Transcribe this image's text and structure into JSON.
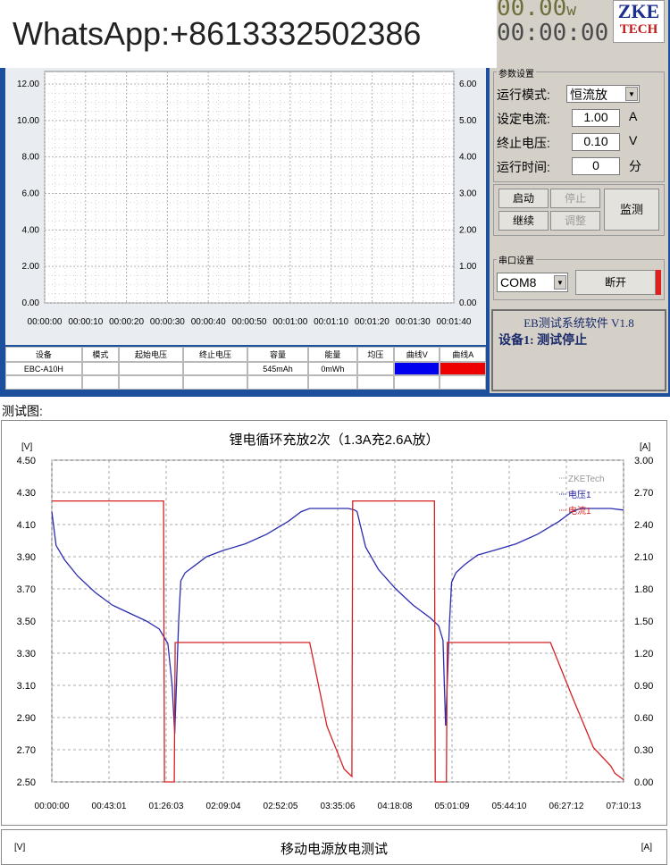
{
  "banner": {
    "text": "WhatsApp:+8613332502386"
  },
  "lcd": {
    "power_value": "00.00",
    "power_unit": "w",
    "time_value": "00:00:00"
  },
  "logo": {
    "line1": "ZKE",
    "line2": "TECH"
  },
  "params": {
    "group_title": "参数设置",
    "mode_label": "运行模式:",
    "mode_value": "恒流放",
    "current_label": "设定电流:",
    "current_value": "1.00",
    "current_unit": "A",
    "stopv_label": "终止电压:",
    "stopv_value": "0.10",
    "stopv_unit": "V",
    "time_label": "运行时间:",
    "time_value": "0",
    "time_unit": "分"
  },
  "buttons": {
    "start": "启动",
    "stop": "停止",
    "continue": "继续",
    "adjust": "调整",
    "monitor": "监测",
    "disconnect": "断开"
  },
  "serial": {
    "group_title": "串口设置",
    "port": "COM8"
  },
  "status": {
    "title": "EB测试系统软件 V1.8",
    "message": "设备1: 测试停止"
  },
  "top_chart": {
    "left_ticks": [
      "12.00",
      "10.00",
      "8.00",
      "6.00",
      "4.00",
      "2.00",
      "0.00"
    ],
    "right_ticks": [
      "6.00",
      "5.00",
      "4.00",
      "3.00",
      "2.00",
      "1.00",
      "0.00"
    ],
    "x_ticks": [
      "00:00:00",
      "00:00:10",
      "00:00:20",
      "00:00:30",
      "00:00:40",
      "00:00:50",
      "00:01:00",
      "00:01:10",
      "00:01:20",
      "00:01:30",
      "00:01:40"
    ]
  },
  "device_table": {
    "headers": [
      "设备",
      "模式",
      "起始电压",
      "终止电压",
      "容量",
      "能量",
      "均压",
      "曲线V",
      "曲线A"
    ],
    "row": [
      "EBC-A10H",
      "",
      "",
      "",
      "545mAh",
      "0mWh",
      "",
      "",
      ""
    ],
    "curve_v_color": "#0000ee",
    "curve_a_color": "#ee0000"
  },
  "caption": "测试图:",
  "chart_data": [
    {
      "type": "line",
      "title": "锂电循环充放2次（1.3A充2.6A放）",
      "y_left_unit": "[V]",
      "y_right_unit": "[A]",
      "y_left_ticks": [
        "4.50",
        "4.30",
        "4.10",
        "3.90",
        "3.70",
        "3.50",
        "3.30",
        "3.10",
        "2.90",
        "2.70",
        "2.50"
      ],
      "y_right_ticks": [
        "3.00",
        "2.70",
        "2.40",
        "2.10",
        "1.80",
        "1.50",
        "1.20",
        "0.90",
        "0.60",
        "0.30",
        "0.00"
      ],
      "x_ticks": [
        "00:00:00",
        "00:43:01",
        "01:26:03",
        "02:09:04",
        "02:52:05",
        "03:35:06",
        "04:18:08",
        "05:01:09",
        "05:44:10",
        "06:27:12",
        "07:10:13"
      ],
      "ylim_left": [
        2.5,
        4.5
      ],
      "ylim_right": [
        0,
        3.0
      ],
      "legend": [
        "ZKETech",
        "电压1",
        "电流1"
      ],
      "legend_colors": [
        "#999999",
        "#2b2bb0",
        "#d42020"
      ],
      "series": [
        {
          "name": "电压1",
          "axis": "left",
          "color": "#2b2bb0",
          "x": [
            0,
            1,
            3,
            6,
            10,
            14,
            18,
            22,
            25,
            27,
            28,
            28.6,
            29,
            29.5,
            30,
            31,
            33,
            36,
            40,
            45,
            50,
            55,
            58,
            60,
            61,
            64,
            67,
            69,
            70.5,
            71,
            73,
            76,
            80,
            84,
            88,
            90,
            91,
            91.6,
            92,
            92.5,
            93,
            94,
            96,
            99,
            103,
            108,
            113,
            118,
            121,
            123,
            124,
            127,
            130,
            133
          ],
          "v": [
            4.18,
            3.97,
            3.88,
            3.78,
            3.68,
            3.6,
            3.55,
            3.5,
            3.45,
            3.36,
            3.1,
            2.8,
            3.1,
            3.5,
            3.75,
            3.8,
            3.84,
            3.9,
            3.94,
            3.98,
            4.04,
            4.12,
            4.18,
            4.2,
            4.2,
            4.2,
            4.2,
            4.2,
            4.19,
            4.18,
            3.96,
            3.82,
            3.7,
            3.6,
            3.52,
            3.47,
            3.38,
            2.85,
            3.12,
            3.48,
            3.74,
            3.8,
            3.85,
            3.91,
            3.94,
            3.98,
            4.04,
            4.12,
            4.18,
            4.2,
            4.2,
            4.2,
            4.2,
            4.19
          ]
        },
        {
          "name": "电流1",
          "axis": "right",
          "color": "#d42020",
          "x": [
            0,
            15,
            26,
            26.2,
            28.5,
            28.7,
            29.8,
            30,
            50,
            55,
            60,
            64,
            68,
            69.8,
            70,
            70.2,
            85,
            89,
            89.2,
            91.8,
            92,
            93,
            93.2,
            111,
            116,
            121,
            126,
            130,
            131,
            133
          ],
          "a": [
            2.62,
            2.62,
            2.62,
            0.0,
            0.0,
            1.3,
            1.3,
            1.3,
            1.3,
            1.3,
            1.3,
            0.52,
            0.12,
            0.05,
            2.62,
            2.62,
            2.62,
            2.62,
            0.0,
            0.0,
            1.3,
            1.3,
            1.3,
            1.3,
            1.3,
            0.8,
            0.32,
            0.15,
            0.08,
            0.02
          ]
        }
      ]
    },
    {
      "type": "line",
      "title": "移动电源放电测试",
      "y_left_unit": "[V]",
      "y_right_unit": "[A]"
    }
  ]
}
